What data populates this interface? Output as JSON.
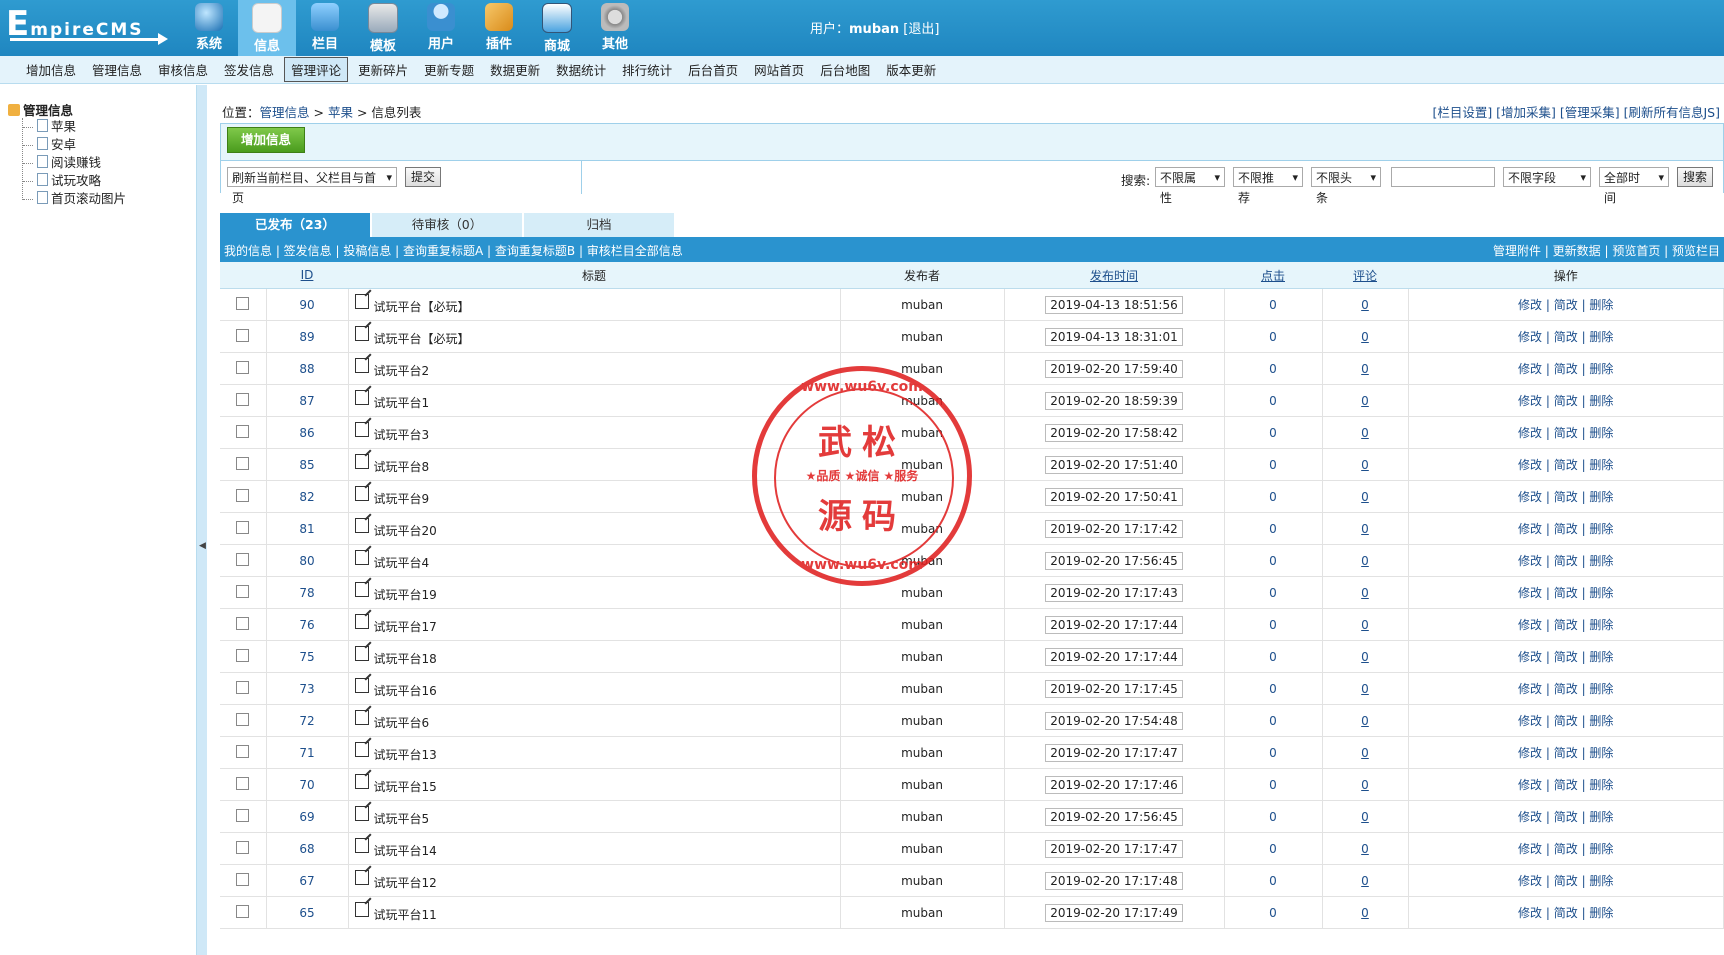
{
  "header": {
    "logo_big": "E",
    "logo_small": "mpireCMS",
    "nav": [
      {
        "label": "系统",
        "icon": "globe-icon"
      },
      {
        "label": "信息",
        "icon": "document-icon",
        "active": true
      },
      {
        "label": "栏目",
        "icon": "folder-icon"
      },
      {
        "label": "模板",
        "icon": "template-icon"
      },
      {
        "label": "用户",
        "icon": "user-icon"
      },
      {
        "label": "插件",
        "icon": "plugin-icon"
      },
      {
        "label": "商城",
        "icon": "shop-icon"
      },
      {
        "label": "其他",
        "icon": "gear-icon"
      }
    ],
    "user_prefix": "用户：",
    "user_name": "muban",
    "logout": "[退出]"
  },
  "subnav": [
    "增加信息",
    "管理信息",
    "审核信息",
    "签发信息",
    "管理评论",
    "更新碎片",
    "更新专题",
    "数据更新",
    "数据统计",
    "排行统计",
    "后台首页",
    "网站首页",
    "后台地图",
    "版本更新"
  ],
  "subnav_active": 4,
  "sidebar": {
    "root": "管理信息",
    "items": [
      "苹果",
      "安卓",
      "阅读赚钱",
      "试玩攻略",
      "首页滚动图片"
    ]
  },
  "breadcrumb": {
    "prefix": "位置：",
    "a": "管理信息",
    "sep1": " > ",
    "b": "苹果",
    "sep2": " > ",
    "c": "信息列表"
  },
  "right_links": "[栏目设置] [增加采集] [管理采集] [刷新所有信息JS]",
  "toolbar": {
    "add_label": "增加信息",
    "refresh_select": "刷新当前栏目、父栏目与首页",
    "submit": "提交",
    "search_label": "搜索:",
    "attr": "不限属性",
    "recommend": "不限推荐",
    "headline": "不限头条",
    "search_value": "",
    "field": "不限字段",
    "time": "全部时间",
    "search_btn": "搜索"
  },
  "tabs": [
    "已发布（23）",
    "待审核（0）",
    "归档"
  ],
  "action_left": "我的信息 | 签发信息 | 投稿信息 | 查询重复标题A | 查询重复标题B | 审核栏目全部信息",
  "action_right": "管理附件 | 更新数据 | 预览首页 | 预览栏目",
  "columns": {
    "id": "ID",
    "title": "标题",
    "author": "发布者",
    "time": "发布时间",
    "clicks": "点击",
    "comments": "评论",
    "ops": "操作"
  },
  "ops_labels": {
    "edit": "修改",
    "simple": "简改",
    "del": "删除"
  },
  "rows": [
    {
      "id": "90",
      "title": "试玩平台【必玩】",
      "author": "muban",
      "time": "2019-04-13 18:51:56",
      "clicks": "0",
      "comments": "0"
    },
    {
      "id": "89",
      "title": "试玩平台【必玩】",
      "author": "muban",
      "time": "2019-04-13 18:31:01",
      "clicks": "0",
      "comments": "0"
    },
    {
      "id": "88",
      "title": "试玩平台2",
      "author": "muban",
      "time": "2019-02-20 17:59:40",
      "clicks": "0",
      "comments": "0"
    },
    {
      "id": "87",
      "title": "试玩平台1",
      "author": "muban",
      "time": "2019-02-20 18:59:39",
      "clicks": "0",
      "comments": "0"
    },
    {
      "id": "86",
      "title": "试玩平台3",
      "author": "muban",
      "time": "2019-02-20 17:58:42",
      "clicks": "0",
      "comments": "0"
    },
    {
      "id": "85",
      "title": "试玩平台8",
      "author": "muban",
      "time": "2019-02-20 17:51:40",
      "clicks": "0",
      "comments": "0"
    },
    {
      "id": "82",
      "title": "试玩平台9",
      "author": "muban",
      "time": "2019-02-20 17:50:41",
      "clicks": "0",
      "comments": "0"
    },
    {
      "id": "81",
      "title": "试玩平台20",
      "author": "muban",
      "time": "2019-02-20 17:17:42",
      "clicks": "0",
      "comments": "0"
    },
    {
      "id": "80",
      "title": "试玩平台4",
      "author": "muban",
      "time": "2019-02-20 17:56:45",
      "clicks": "0",
      "comments": "0"
    },
    {
      "id": "78",
      "title": "试玩平台19",
      "author": "muban",
      "time": "2019-02-20 17:17:43",
      "clicks": "0",
      "comments": "0"
    },
    {
      "id": "76",
      "title": "试玩平台17",
      "author": "muban",
      "time": "2019-02-20 17:17:44",
      "clicks": "0",
      "comments": "0"
    },
    {
      "id": "75",
      "title": "试玩平台18",
      "author": "muban",
      "time": "2019-02-20 17:17:44",
      "clicks": "0",
      "comments": "0"
    },
    {
      "id": "73",
      "title": "试玩平台16",
      "author": "muban",
      "time": "2019-02-20 17:17:45",
      "clicks": "0",
      "comments": "0"
    },
    {
      "id": "72",
      "title": "试玩平台6",
      "author": "muban",
      "time": "2019-02-20 17:54:48",
      "clicks": "0",
      "comments": "0"
    },
    {
      "id": "71",
      "title": "试玩平台13",
      "author": "muban",
      "time": "2019-02-20 17:17:47",
      "clicks": "0",
      "comments": "0"
    },
    {
      "id": "70",
      "title": "试玩平台15",
      "author": "muban",
      "time": "2019-02-20 17:17:46",
      "clicks": "0",
      "comments": "0"
    },
    {
      "id": "69",
      "title": "试玩平台5",
      "author": "muban",
      "time": "2019-02-20 17:56:45",
      "clicks": "0",
      "comments": "0"
    },
    {
      "id": "68",
      "title": "试玩平台14",
      "author": "muban",
      "time": "2019-02-20 17:17:47",
      "clicks": "0",
      "comments": "0"
    },
    {
      "id": "67",
      "title": "试玩平台12",
      "author": "muban",
      "time": "2019-02-20 17:17:48",
      "clicks": "0",
      "comments": "0"
    },
    {
      "id": "65",
      "title": "试玩平台11",
      "author": "muban",
      "time": "2019-02-20 17:17:49",
      "clicks": "0",
      "comments": "0"
    }
  ],
  "stamp": {
    "url": "www.wu6v.com",
    "line1": "武松",
    "mid": "★品质 ★诚信 ★服务",
    "line2": "源码",
    "color": "#e02020"
  }
}
